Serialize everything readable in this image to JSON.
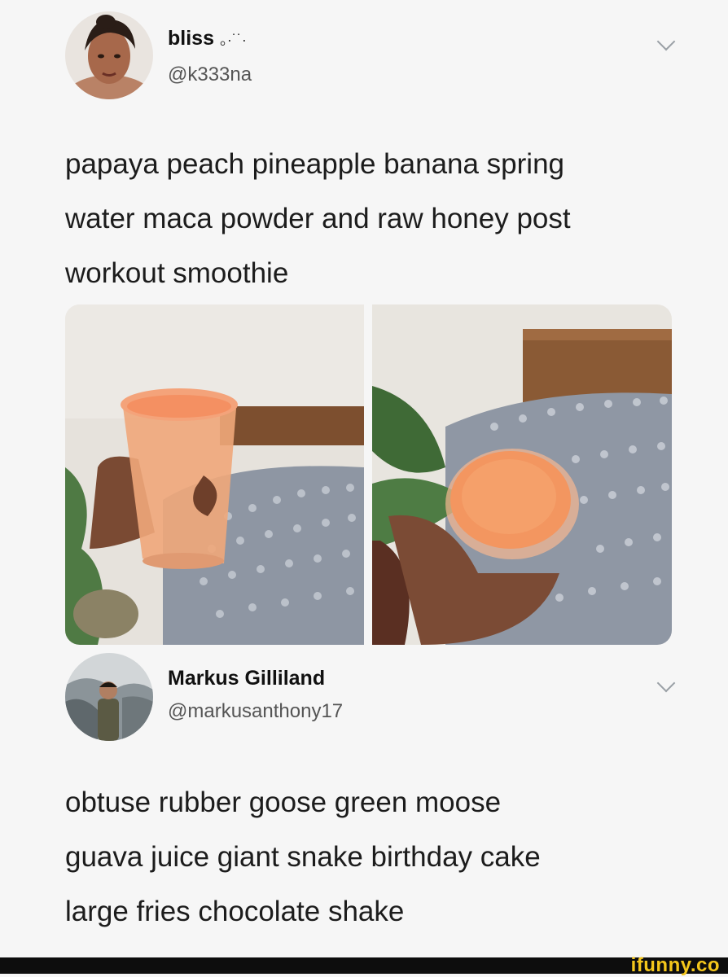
{
  "tweet": {
    "name": "bliss",
    "name_deco": "。·˙˙·",
    "handle": "@k333na",
    "text_lines": [
      "papaya peach pineapple banana spring",
      "water maca powder and raw honey post",
      "workout smoothie"
    ],
    "photos": [
      "smoothie-glass-held-near-bed",
      "smoothie-glass-held-from-above"
    ]
  },
  "reply": {
    "name": "Markus Gilliland",
    "handle": "@markusanthony17",
    "text_lines": [
      "obtuse rubber goose green moose",
      "guava juice giant snake birthday cake",
      "large fries chocolate shake"
    ]
  },
  "watermark": {
    "text": "ifunny.co"
  },
  "icons": {
    "menu": "chevron-down-icon"
  },
  "colors": {
    "accent": "#f4c61b",
    "footer": "#0d0d0d"
  }
}
